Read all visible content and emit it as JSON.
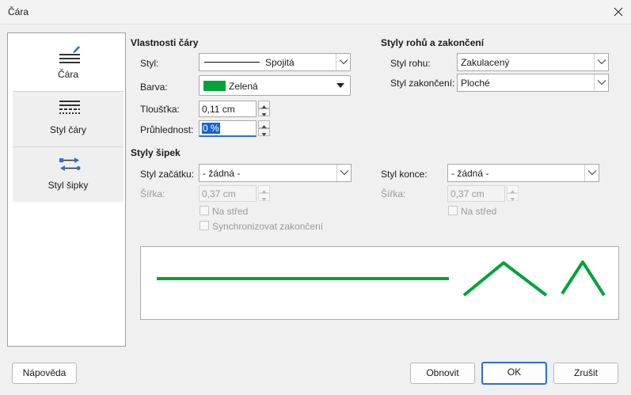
{
  "window": {
    "title": "Čára"
  },
  "sidebar": {
    "items": [
      {
        "label": "Čára",
        "icon": "line-icon",
        "active": true
      },
      {
        "label": "Styl čáry",
        "icon": "line-style-icon",
        "active": false
      },
      {
        "label": "Styl šipky",
        "icon": "arrow-style-icon",
        "active": false
      }
    ]
  },
  "line_props": {
    "heading": "Vlastnosti čáry",
    "style_label": "Styl:",
    "style_value": "Spojitá",
    "color_label": "Barva:",
    "color_value": "Zelená",
    "color_hex": "#00a33a",
    "width_label": "Tloušťka:",
    "width_value": "0,11 cm",
    "transparency_label": "Průhlednost:",
    "transparency_value": "0 %"
  },
  "corners": {
    "heading": "Styly rohů a zakončení",
    "corner_label": "Styl rohu:",
    "corner_value": "Zakulacený",
    "cap_label": "Styl zakončení:",
    "cap_value": "Ploché"
  },
  "arrows": {
    "heading": "Styly šipek",
    "start_label": "Styl začátku:",
    "start_value": "- žádná -",
    "start_width_label": "Šířka:",
    "start_width_value": "0,37 cm",
    "start_center_label": "Na střed",
    "sync_label": "Synchronizovat zakončení",
    "end_label": "Styl konce:",
    "end_value": "- žádná -",
    "end_width_label": "Šířka:",
    "end_width_value": "0,37 cm",
    "end_center_label": "Na střed"
  },
  "buttons": {
    "help": "Nápověda",
    "reset": "Obnovit",
    "ok": "OK",
    "cancel": "Zrušit"
  },
  "colors": {
    "preview_line": "#00a33a",
    "accent": "#2b6fcf"
  }
}
